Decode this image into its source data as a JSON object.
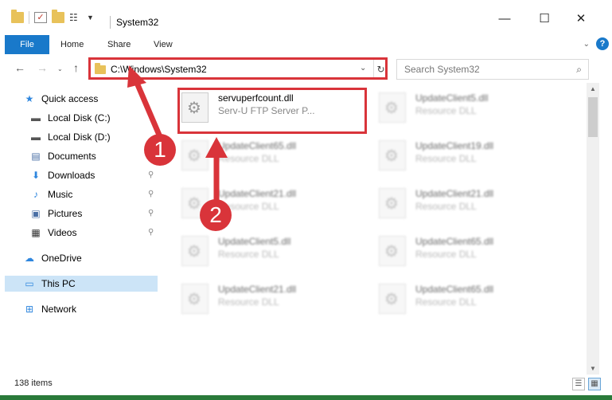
{
  "window": {
    "title": "System32",
    "controls": {
      "minimize": "—",
      "maximize": "☐",
      "close": "✕"
    }
  },
  "ribbon": {
    "tabs": [
      {
        "label": "File"
      },
      {
        "label": "Home"
      },
      {
        "label": "Share"
      },
      {
        "label": "View"
      }
    ],
    "help": "?"
  },
  "address": {
    "path": "C:\\Windows\\System32",
    "search_placeholder": "Search System32"
  },
  "sidebar": {
    "quick_access": "Quick access",
    "items": [
      {
        "label": "Local Disk (C:)"
      },
      {
        "label": "Local Disk (D:)"
      },
      {
        "label": "Documents"
      },
      {
        "label": "Downloads"
      },
      {
        "label": "Music"
      },
      {
        "label": "Pictures"
      },
      {
        "label": "Videos"
      }
    ],
    "onedrive": "OneDrive",
    "this_pc": "This PC",
    "network": "Network"
  },
  "files": [
    {
      "name": "servuperfcount.dll",
      "desc": "Serv-U FTP Server P..."
    },
    {
      "name": "UpdateClient5.dll",
      "desc": "Resource DLL"
    },
    {
      "name": "UpdateClient65.dll",
      "desc": "Resource DLL"
    },
    {
      "name": "UpdateClient19.dll",
      "desc": "Resource DLL"
    },
    {
      "name": "UpdateClient21.dll",
      "desc": "Resource DLL"
    },
    {
      "name": "UpdateClient21.dll",
      "desc": "Resource DLL"
    },
    {
      "name": "UpdateClient5.dll",
      "desc": "Resource DLL"
    },
    {
      "name": "UpdateClient65.dll",
      "desc": "Resource DLL"
    },
    {
      "name": "UpdateClient21.dll",
      "desc": "Resource DLL"
    },
    {
      "name": "UpdateClient65.dll",
      "desc": "Resource DLL"
    }
  ],
  "status": {
    "count": "138 items"
  },
  "annotations": {
    "badge1": "1",
    "badge2": "2"
  },
  "colors": {
    "accent": "#1979ca",
    "highlight": "#d9343a",
    "selected": "#cce4f7"
  }
}
